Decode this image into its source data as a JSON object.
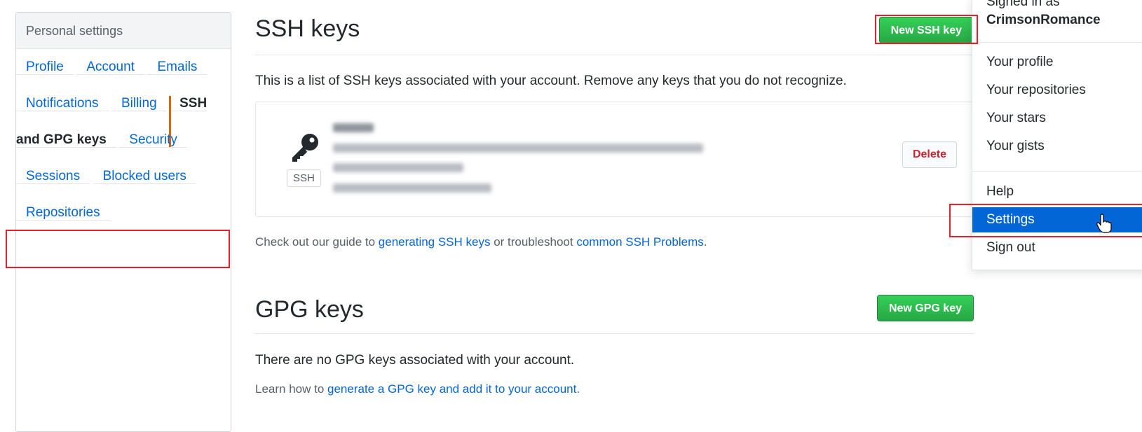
{
  "sidebar": {
    "header": "Personal settings",
    "items": [
      {
        "label": "Profile"
      },
      {
        "label": "Account"
      },
      {
        "label": "Emails"
      },
      {
        "label": "Notifications"
      },
      {
        "label": "Billing"
      },
      {
        "label": "SSH and GPG keys",
        "selected": true
      },
      {
        "label": "Security"
      },
      {
        "label": "Sessions"
      },
      {
        "label": "Blocked users"
      },
      {
        "label": "Repositories"
      }
    ]
  },
  "ssh": {
    "title": "SSH keys",
    "new_button": "New SSH key",
    "description": "This is a list of SSH keys associated with your account. Remove any keys that you do not recognize.",
    "key": {
      "type_label": "SSH",
      "delete_label": "Delete"
    },
    "guide": {
      "prefix": "Check out our guide to ",
      "link1": "generating SSH keys",
      "middle": " or troubleshoot ",
      "link2": "common SSH Problems",
      "suffix": "."
    }
  },
  "gpg": {
    "title": "GPG keys",
    "new_button": "New GPG key",
    "description": "There are no GPG keys associated with your account.",
    "learn": {
      "prefix": "Learn how to ",
      "link": "generate a GPG key and add it to your account",
      "suffix": "."
    }
  },
  "dropdown": {
    "signed_in_label": "Signed in as",
    "username": "CrimsonRomance",
    "items": [
      "Your profile",
      "Your repositories",
      "Your stars",
      "Your gists",
      "Help",
      "Settings",
      "Sign out"
    ],
    "active": "Settings"
  },
  "colors": {
    "link": "#0366d6",
    "primary_button": "#28a745",
    "danger": "#cb2431",
    "highlight": "#e8202a",
    "selected_accent": "#e36209"
  }
}
